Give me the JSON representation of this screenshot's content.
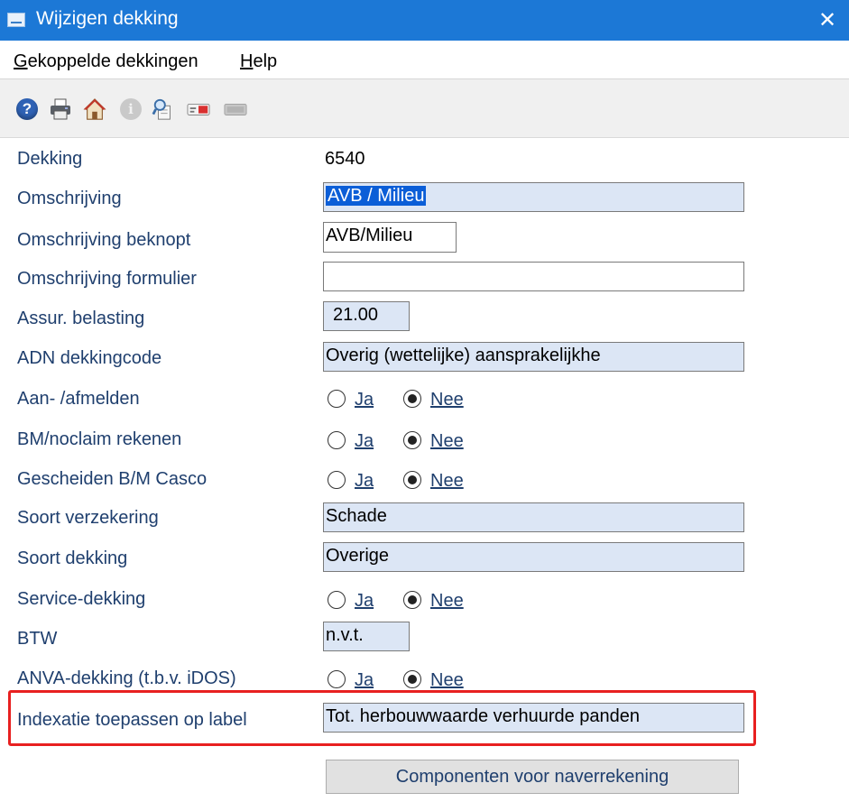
{
  "window": {
    "title": "Wijzigen dekking",
    "close": "✕"
  },
  "menu": [
    {
      "accel": "G",
      "rest": "ekoppelde dekkingen"
    },
    {
      "accel": "H",
      "rest": "elp"
    }
  ],
  "toolbar": {
    "icons": [
      "help-icon",
      "print-icon",
      "home-icon",
      "info-icon",
      "search-icon",
      "card-icon",
      "keyboard-icon"
    ],
    "help_glyph": "?",
    "info_glyph": "i"
  },
  "radio_labels": {
    "yes": "Ja",
    "no": "Nee"
  },
  "fields": {
    "dekking": {
      "label": "Dekking",
      "value": "6540"
    },
    "omschrijving": {
      "label": "Omschrijving",
      "value": "AVB / Milieu"
    },
    "omschrijving_beknopt": {
      "label": "Omschrijving beknopt",
      "value": "AVB/Milieu"
    },
    "omschrijving_formulier": {
      "label": "Omschrijving formulier",
      "value": ""
    },
    "assur_belasting": {
      "label": "Assur. belasting",
      "value": "21.00"
    },
    "adn_dekkingcode": {
      "label": "ADN dekkingcode",
      "value": "Overig (wettelijke) aansprakelijkhe"
    },
    "aan_afmelden": {
      "label": "Aan- /afmelden",
      "selected": "Nee"
    },
    "bm_noclaim": {
      "label": "BM/noclaim rekenen",
      "selected": "Nee"
    },
    "gescheiden_bm": {
      "label": "Gescheiden B/M Casco",
      "selected": "Nee"
    },
    "soort_verzekering": {
      "label": "Soort verzekering",
      "value": "Schade"
    },
    "soort_dekking": {
      "label": "Soort dekking",
      "value": "Overige"
    },
    "service_dekking": {
      "label": "Service-dekking",
      "selected": "Nee"
    },
    "btw": {
      "label": "BTW",
      "value": "n.v.t."
    },
    "anva_dekking": {
      "label": "ANVA-dekking (t.b.v. iDOS)",
      "selected": "Nee"
    },
    "indexatie": {
      "label": "Indexatie toepassen op label",
      "value": "Tot. herbouwwaarde verhuurde panden"
    }
  },
  "buttons": {
    "componenten": "Componenten voor naverrekening"
  },
  "colors": {
    "titlebar": "#1c78d6",
    "label": "#1f3f6e",
    "readonly_bg": "#dce6f5",
    "highlight": "#e82020",
    "selection": "#0b5ed7"
  }
}
